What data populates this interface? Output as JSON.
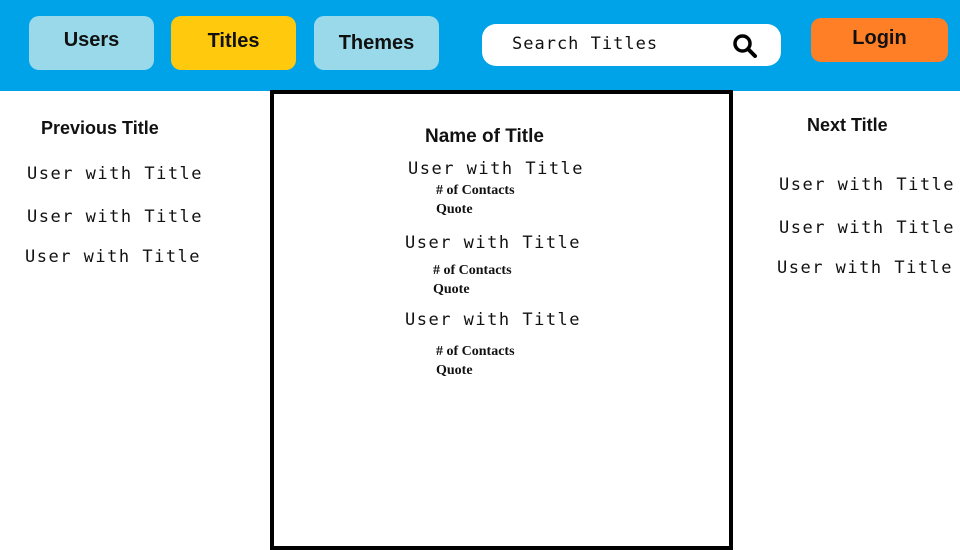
{
  "nav": {
    "users_label": "Users",
    "titles_label": "Titles",
    "themes_label": "Themes",
    "login_label": "Login"
  },
  "search": {
    "placeholder": "Search Titles",
    "icon": "search-icon"
  },
  "left_panel": {
    "heading": "Previous Title",
    "items": [
      "User with Title",
      "User with Title",
      "User with Title"
    ]
  },
  "center_panel": {
    "heading": "Name of Title",
    "entries": [
      {
        "user": "User with Title",
        "contacts": "# of Contacts",
        "quote": "Quote"
      },
      {
        "user": "User with Title",
        "contacts": "# of Contacts",
        "quote": "Quote"
      },
      {
        "user": "User with Title",
        "contacts": "# of Contacts",
        "quote": "Quote"
      }
    ]
  },
  "right_panel": {
    "heading": "Next Title",
    "items": [
      "User with Title",
      "User with Title",
      "User with Title"
    ]
  },
  "colors": {
    "topbar": "#00a2e8",
    "nav_inactive": "#99d9ea",
    "nav_active": "#ffc90e",
    "login": "#ff7f27"
  }
}
